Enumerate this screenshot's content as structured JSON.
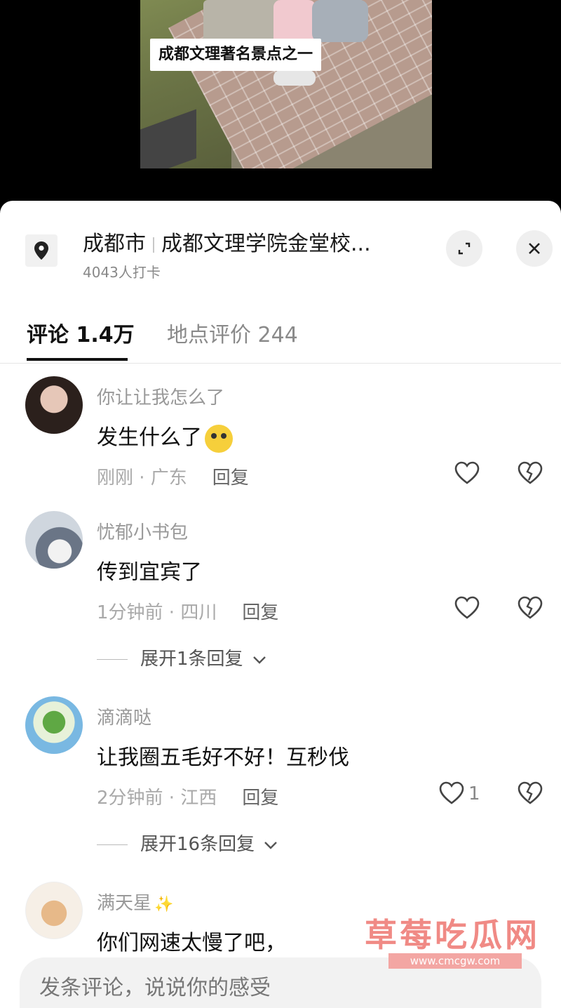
{
  "video": {
    "caption": "成都文理著名景点之一"
  },
  "location": {
    "city": "成都市",
    "place": "成都文理学院金堂校...",
    "checkins": "4043人打卡",
    "icon": "location-pin-icon"
  },
  "tabs": [
    {
      "label": "评论 1.4万"
    },
    {
      "label": "地点评价 244"
    }
  ],
  "comments": [
    {
      "user": "你让让我怎么了",
      "text": "发生什么了",
      "time_region": "刚刚 · 广东",
      "reply_label": "回复",
      "likes": ""
    },
    {
      "user": "忧郁小书包",
      "text": "传到宜宾了",
      "time_region": "1分钟前 · 四川",
      "reply_label": "回复",
      "likes": "",
      "expand_label": "展开1条回复"
    },
    {
      "user": "滴滴哒",
      "text": "让我圈五毛好不好！互秒伐",
      "time_region": "2分钟前 · 江西",
      "reply_label": "回复",
      "likes": "1",
      "expand_label": "展开16条回复"
    },
    {
      "user": "满天星",
      "text": "你们网速太慢了吧，"
    }
  ],
  "input": {
    "placeholder": "发条评论，说说你的感受"
  },
  "watermark": {
    "title": "草莓吃瓜网",
    "url": "www.cmcgw.com"
  },
  "colors": {
    "accent_dark": "#111111",
    "muted": "#999999",
    "watermark": "#f08a85"
  }
}
